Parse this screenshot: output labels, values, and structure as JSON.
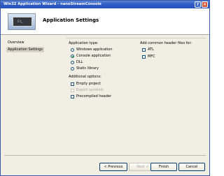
{
  "window": {
    "title": "Win32 Application Wizard - nanoStreamConsole"
  },
  "titlebar": {
    "help": "?",
    "close": "×"
  },
  "header": {
    "title": "Application Settings",
    "image_text": "C:\\_"
  },
  "nav": {
    "items": [
      "Overview",
      "Application Settings"
    ],
    "active": "Application Settings"
  },
  "app_type": {
    "label": "Application type:",
    "options": [
      {
        "label": "Windows application",
        "selected": false
      },
      {
        "label": "Console application",
        "selected": true
      },
      {
        "label": "DLL",
        "selected": false
      },
      {
        "label": "Static library",
        "selected": false
      }
    ]
  },
  "additional": {
    "label": "Additional options:",
    "options": [
      {
        "label": "Empty project",
        "checked": false,
        "enabled": true
      },
      {
        "label": "Export symbols",
        "checked": false,
        "enabled": false
      },
      {
        "label": "Precompiled header",
        "checked": false,
        "enabled": true
      }
    ]
  },
  "headers": {
    "label": "Add common header files for:",
    "options": [
      {
        "label": "ATL",
        "checked": false
      },
      {
        "label": "MFC",
        "checked": false
      }
    ]
  },
  "buttons": {
    "previous": "< Previous",
    "next": "Next >",
    "finish": "Finish",
    "cancel": "Cancel"
  }
}
